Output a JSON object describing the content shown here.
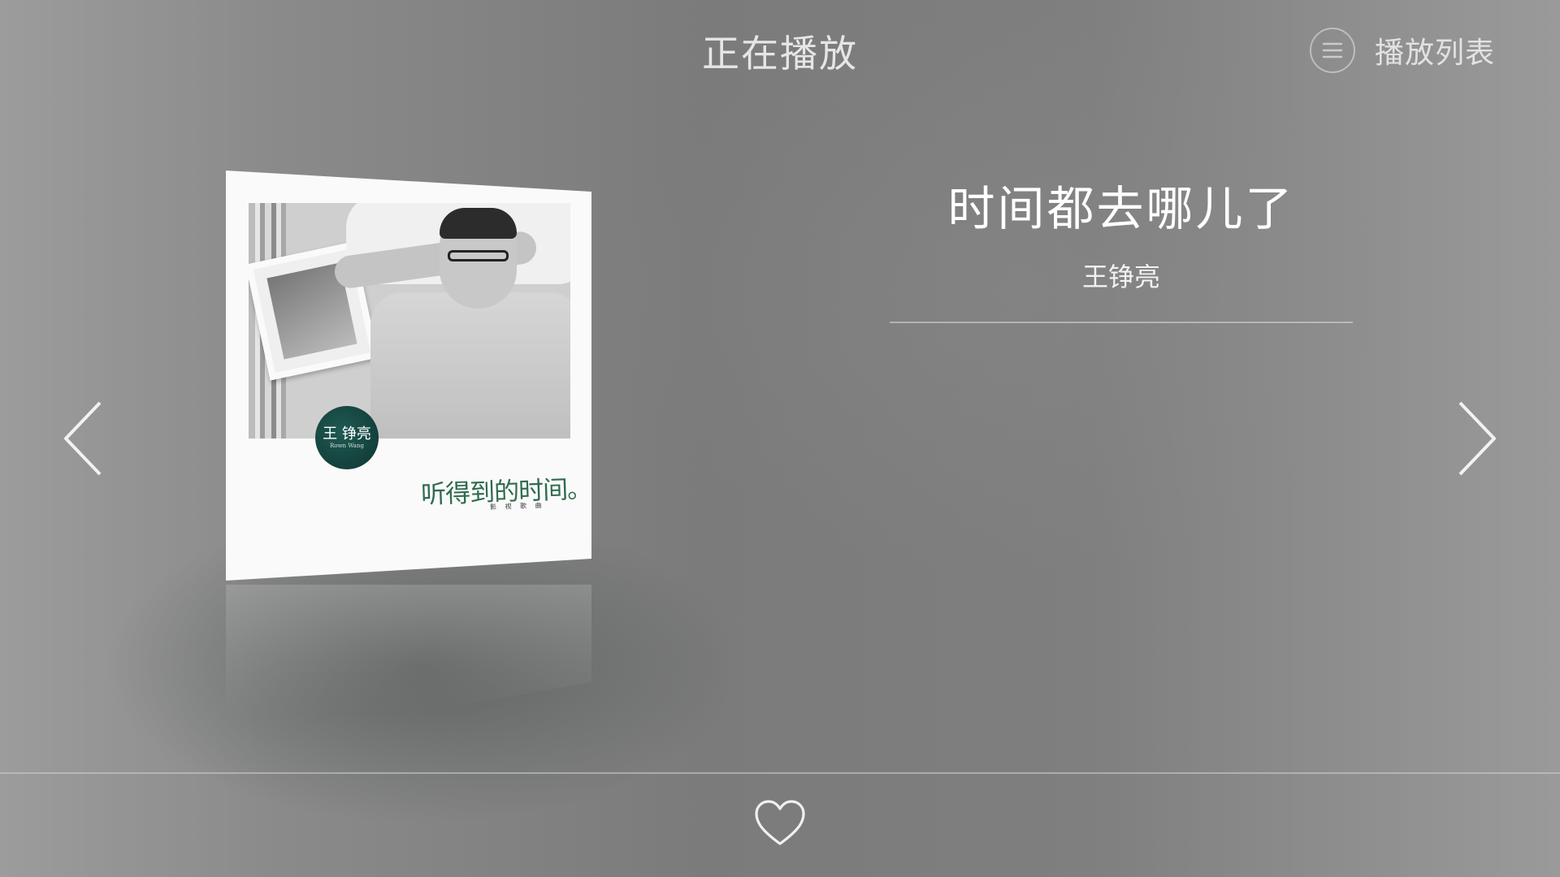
{
  "header": {
    "title": "正在播放",
    "playlist_label": "播放列表",
    "playlist_icon": "list-icon"
  },
  "navigation": {
    "prev_icon": "chevron-left-icon",
    "next_icon": "chevron-right-icon"
  },
  "album": {
    "artist_badge": "王 铮亮",
    "badge_subtext": "Rown Wang",
    "album_title": "听得到的时间。",
    "album_subtitle": "影 视 歌 曲"
  },
  "song": {
    "title": "时间都去哪儿了",
    "artist": "王铮亮"
  },
  "footer": {
    "favorite_icon": "heart-icon"
  },
  "colors": {
    "text_primary": "#ffffff",
    "text_secondary": "#e6e6e6",
    "album_green": "#2f6b4d",
    "badge_green": "#1f5a52"
  }
}
